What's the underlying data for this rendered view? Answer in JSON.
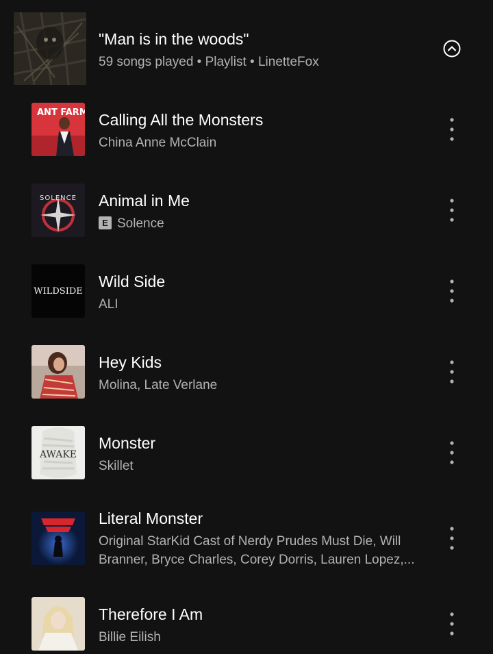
{
  "playlist": {
    "title": "\"Man is in the woods\"",
    "subtitle": "59 songs played • Playlist • LinetteFox",
    "collapse_icon": "chevron-up-circle-icon"
  },
  "tracks": [
    {
      "title": "Calling All the Monsters",
      "artist": "China Anne McClain",
      "cover_text": "ANT FARM",
      "explicit": false
    },
    {
      "title": "Animal in Me",
      "artist": "Solence",
      "cover_text": "SOLENCE",
      "explicit": true,
      "explicit_label": "E"
    },
    {
      "title": "Wild Side",
      "artist": "ALI",
      "cover_text": "WILDSIDE",
      "explicit": false
    },
    {
      "title": "Hey Kids",
      "artist": "Molina, Late Verlane",
      "explicit": false
    },
    {
      "title": "Monster",
      "artist": "Skillet",
      "cover_text": "AWAKE",
      "explicit": false
    },
    {
      "title": "Literal Monster",
      "artist": "Original StarKid Cast of Nerdy Prudes Must Die, Will Branner, Bryce Charles, Corey Dorris, Lauren Lopez,...",
      "explicit": false
    },
    {
      "title": "Therefore I Am",
      "artist": "Billie Eilish",
      "explicit": false
    }
  ],
  "colors": {
    "background": "#121212",
    "primary_text": "#ffffff",
    "secondary_text": "#b3b3b3"
  },
  "more_icon": "more-vertical-icon"
}
